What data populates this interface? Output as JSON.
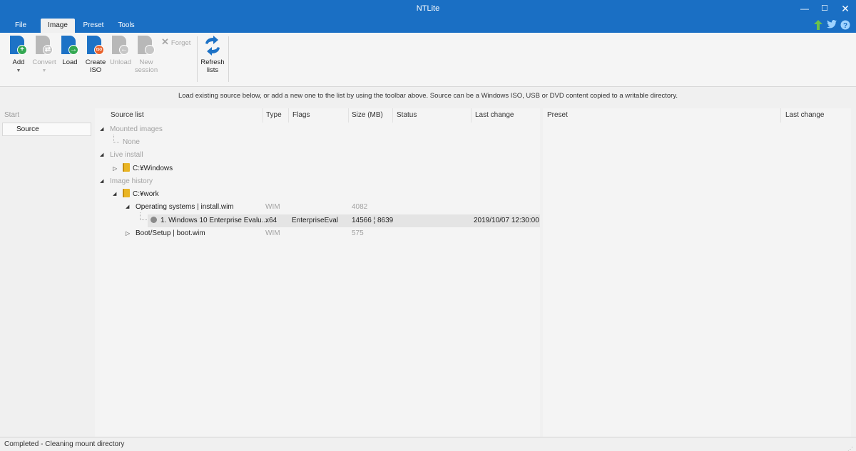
{
  "window": {
    "title": "NTLite",
    "minimize_glyph": "—",
    "maximize_glyph": "☐",
    "close_glyph": "✕"
  },
  "menu": {
    "tabs": [
      {
        "label": "File"
      },
      {
        "label": "Image",
        "active": true
      },
      {
        "label": "Preset"
      },
      {
        "label": "Tools"
      }
    ],
    "icons": [
      "update-arrow-icon",
      "twitter-icon",
      "help-icon"
    ]
  },
  "ribbon": {
    "add": {
      "label": "Add",
      "icon": "add-image-icon"
    },
    "convert": {
      "label": "Convert",
      "icon": "convert-image-icon"
    },
    "load": {
      "label": "Load",
      "icon": "load-image-icon"
    },
    "create_iso": {
      "label_1": "Create",
      "label_2": "ISO",
      "icon": "create-iso-icon"
    },
    "unload": {
      "label": "Unload",
      "icon": "unload-image-icon"
    },
    "new_session": {
      "label_1": "New",
      "label_2": "session",
      "icon": "new-session-icon"
    },
    "forget": {
      "label": "Forget",
      "icon": "forget-icon"
    },
    "refresh": {
      "label_1": "Refresh",
      "label_2": "lists",
      "icon": "refresh-lists-icon"
    }
  },
  "info_text": "Load existing source below, or add a new one to the list by using the toolbar above. Source can be a Windows ISO, USB or DVD content copied to a writable directory.",
  "nav": {
    "start": "Start",
    "source": "Source"
  },
  "source_list": {
    "columns": [
      "Source list",
      "Type",
      "Flags",
      "Size (MB)",
      "Status",
      "Last change"
    ],
    "mounted_group": "Mounted images",
    "mounted_none": "None",
    "live_group": "Live install",
    "live_item": "C:¥Windows",
    "history_group": "Image history",
    "history_folder": "C:¥work",
    "os_item": {
      "name": "Operating systems  |  install.wim",
      "type": "WIM",
      "size": "4082"
    },
    "os_edition": {
      "name": "1. Windows 10 Enterprise Evalu...",
      "type": "x64",
      "flags": "EnterpriseEval",
      "size": "14566 ¦ 8639",
      "last_change": "2019/10/07 12:30:00"
    },
    "boot_item": {
      "name": "Boot/Setup  |  boot.wim",
      "type": "WIM",
      "size": "575"
    }
  },
  "preset_list": {
    "columns": [
      "Preset",
      "Last change"
    ]
  },
  "status_bar": "Completed - Cleaning mount directory",
  "colors": {
    "accent": "#1a6fc4",
    "folder": "#e9b524",
    "add_badge": "#33a852",
    "iso_badge": "#e8622c"
  }
}
